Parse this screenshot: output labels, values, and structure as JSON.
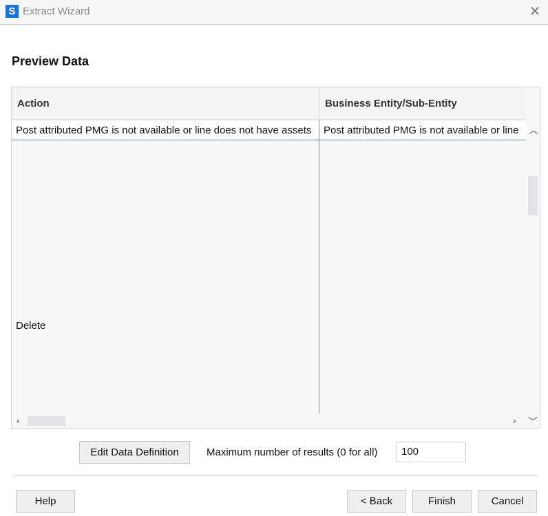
{
  "window": {
    "title": "Extract Wizard",
    "logo": "S"
  },
  "page": {
    "heading": "Preview Data"
  },
  "table": {
    "columns": [
      "Action",
      "Business Entity/Sub-Entity"
    ],
    "rows": [
      [
        "Post attributed PMG is not available or line does not have assets",
        "Post attributed PMG is not available or line"
      ],
      [
        "Delete",
        ""
      ]
    ]
  },
  "controls": {
    "edit_label": "Edit Data Definition",
    "max_label": "Maximum number of results (0 for all)",
    "max_value": "100"
  },
  "footer": {
    "help": "Help",
    "back": "< Back",
    "finish": "Finish",
    "cancel": "Cancel"
  }
}
